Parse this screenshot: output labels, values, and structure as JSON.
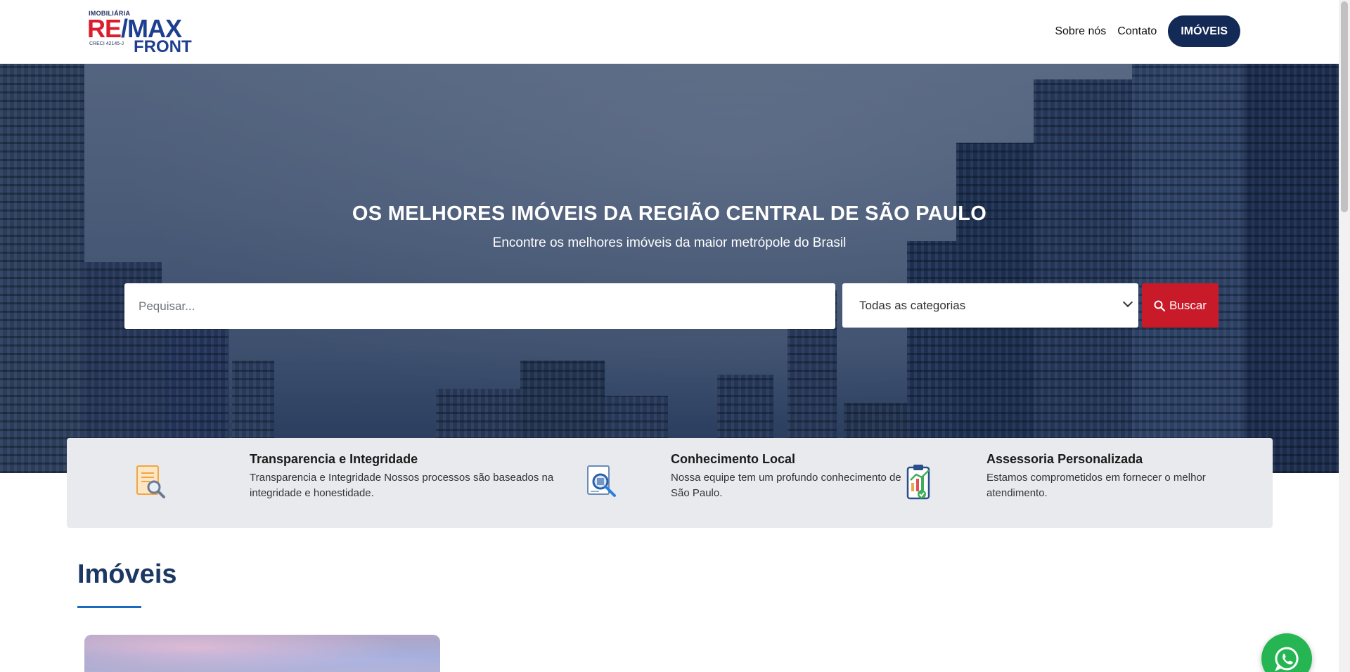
{
  "logo": {
    "small": "IMOBILIÁRIA",
    "re": "RE",
    "slash": "/",
    "max": "MAX",
    "creci": "CRECI 42145-J",
    "front": "FRONT"
  },
  "nav": {
    "items": [
      {
        "label": "Sobre nós"
      },
      {
        "label": "Contato"
      }
    ],
    "cta": "IMÓVEIS"
  },
  "hero": {
    "title": "OS MELHORES IMÓVEIS DA REGIÃO CENTRAL DE SÃO PAULO",
    "subtitle": "Encontre os melhores imóveis da maior metrópole do Brasil"
  },
  "search": {
    "placeholder": "Pequisar...",
    "category_selected": "Todas as categorias",
    "button_label": "Buscar"
  },
  "features": [
    {
      "title": "Transparencia e Integridade",
      "desc": "Transparencia e Integridade Nossos processos são baseados na integridade e honestidade.",
      "icon": "document-magnifier-icon"
    },
    {
      "title": "Conhecimento Local",
      "desc": "Nossa equipe tem um profundo conhecimento de São Paulo.",
      "icon": "map-search-icon"
    },
    {
      "title": "Assessoria Personalizada",
      "desc": "Estamos comprometidos em fornecer o melhor atendimento.",
      "icon": "clipboard-chart-icon"
    }
  ],
  "section": {
    "title": "Imóveis"
  },
  "colors": {
    "brand_navy": "#132956",
    "brand_red": "#c81a28",
    "whatsapp_green": "#25b553"
  }
}
